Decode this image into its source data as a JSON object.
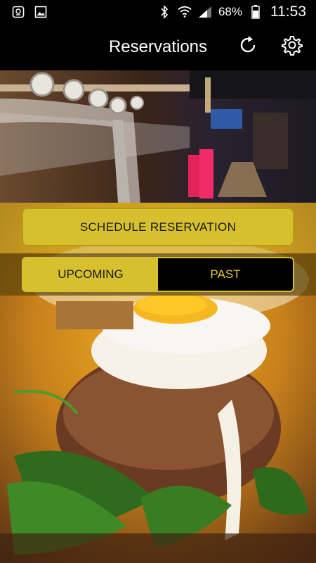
{
  "status_bar": {
    "battery": "68%",
    "time": "11:53",
    "icons": [
      "app-notification-icon",
      "image-icon",
      "bluetooth-icon",
      "wifi-icon",
      "signal-icon",
      "battery-icon"
    ]
  },
  "header": {
    "title": "Reservations",
    "icons": [
      "refresh-icon",
      "gear-icon"
    ]
  },
  "actions": {
    "schedule_label": "SCHEDULE RESERVATION"
  },
  "tabs": [
    {
      "label": "UPCOMING",
      "selected": true
    },
    {
      "label": "PAST",
      "selected": false
    }
  ],
  "colors": {
    "accent": "#d7c02e",
    "accent_text": "#e5c933",
    "background": "#000000"
  }
}
